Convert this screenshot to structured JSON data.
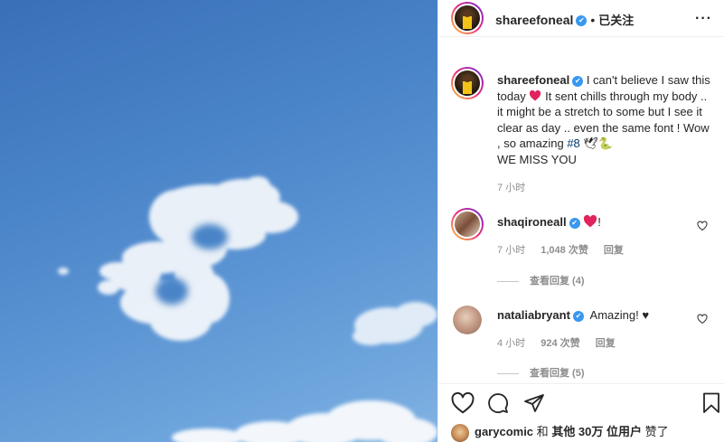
{
  "post": {
    "author": "shareefoneal",
    "follow_label": "已关注",
    "more_label": "···"
  },
  "caption": {
    "username": "shareefoneal",
    "text_1": "I can't believe I saw this today",
    "text_2": "It sent chills through my body .. it might be a stretch to some but I see it clear as day .. even the same font ! Wow , so amazing",
    "hashtag": "#8",
    "emoji_tail": "🕊🐍",
    "text_3": "WE MISS YOU",
    "time": "7 小时"
  },
  "comments": [
    {
      "username": "shaqironeall",
      "text": "!",
      "time": "7 小时",
      "likes": "1,048 次赞",
      "reply_label": "回复",
      "view_replies": "查看回复 (4)"
    },
    {
      "username": "nataliabryant",
      "text": "Amazing! ♥",
      "time": "4 小时",
      "likes": "924 次赞",
      "reply_label": "回复",
      "view_replies": "查看回复 (5)"
    }
  ],
  "likes_line": {
    "user": "garycomic",
    "middle": "和",
    "others": "其他 30万 位用户",
    "tail": "赞了"
  },
  "icons": {
    "like": "heart-outline-icon",
    "comment": "comment-bubble-icon",
    "share": "paper-plane-icon",
    "save": "bookmark-icon",
    "verified": "verified-badge-icon"
  },
  "colors": {
    "verified_blue": "#3897f0",
    "text": "#262626",
    "secondary": "#8e8e8e",
    "heart_red": "#ed4956",
    "hashtag": "#00376b"
  }
}
